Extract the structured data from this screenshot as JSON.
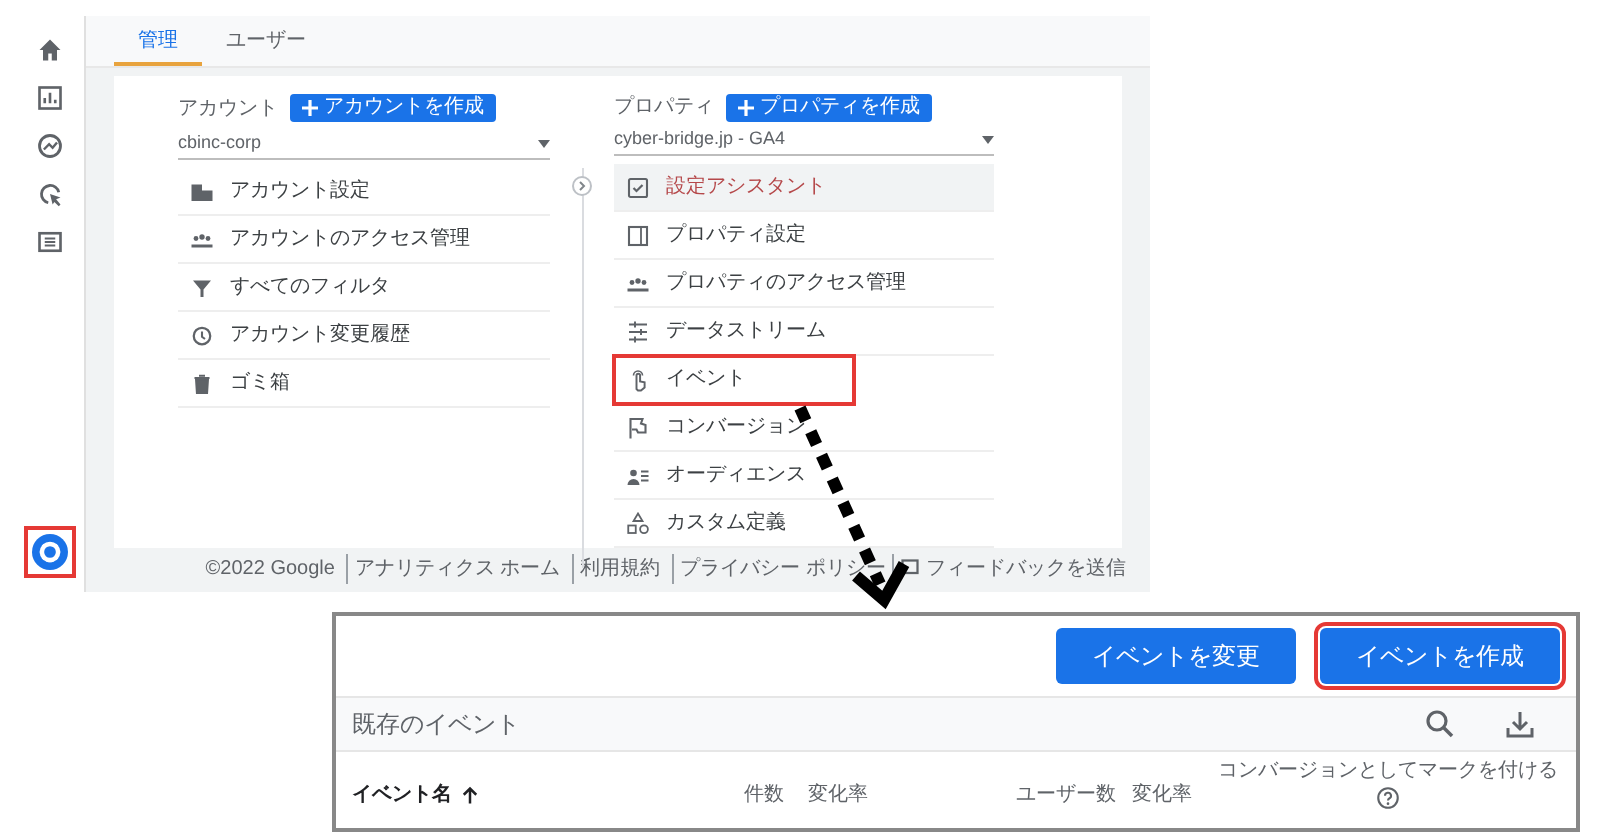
{
  "tabs": [
    {
      "label": "管理",
      "selected": true
    },
    {
      "label": "ユーザー",
      "selected": false
    }
  ],
  "account": {
    "label": "アカウント",
    "create_button": "アカウントを作成",
    "selected_value": "cbinc-corp",
    "items": [
      {
        "label": "アカウント設定"
      },
      {
        "label": "アカウントのアクセス管理"
      },
      {
        "label": "すべてのフィルタ"
      },
      {
        "label": "アカウント変更履歴"
      },
      {
        "label": "ゴミ箱"
      }
    ]
  },
  "property": {
    "label": "プロパティ",
    "create_button": "プロパティを作成",
    "selected_value": "cyber-bridge.jp - GA4",
    "items": [
      {
        "label": "設定アシスタント",
        "selected": true,
        "highlighted": false
      },
      {
        "label": "プロパティ設定",
        "selected": false,
        "highlighted": false
      },
      {
        "label": "プロパティのアクセス管理",
        "selected": false,
        "highlighted": false
      },
      {
        "label": "データストリーム",
        "selected": false,
        "highlighted": false
      },
      {
        "label": "イベント",
        "selected": false,
        "highlighted": true
      },
      {
        "label": "コンバージョン",
        "selected": false,
        "highlighted": false
      },
      {
        "label": "オーディエンス",
        "selected": false,
        "highlighted": false
      },
      {
        "label": "カスタム定義",
        "selected": false,
        "highlighted": false
      }
    ]
  },
  "footer": {
    "copyright": "©2022 Google",
    "links": [
      "アナリティクス ホーム",
      "利用規約",
      "プライバシー ポリシー"
    ],
    "feedback": "フィードバックを送信"
  },
  "events_panel": {
    "buttons": [
      {
        "label": "イベントを変更",
        "highlighted": false
      },
      {
        "label": "イベントを作成",
        "highlighted": true
      }
    ],
    "title": "既存のイベント",
    "columns": [
      {
        "label": "イベント名",
        "sorted": true
      },
      {
        "label": "件数",
        "sorted": false
      },
      {
        "label": "変化率",
        "sorted": false
      },
      {
        "label": "ユーザー数",
        "sorted": false
      },
      {
        "label": "変化率",
        "sorted": false
      },
      {
        "label": "コンバージョンとしてマークを付ける",
        "sorted": false,
        "help": true
      }
    ]
  }
}
